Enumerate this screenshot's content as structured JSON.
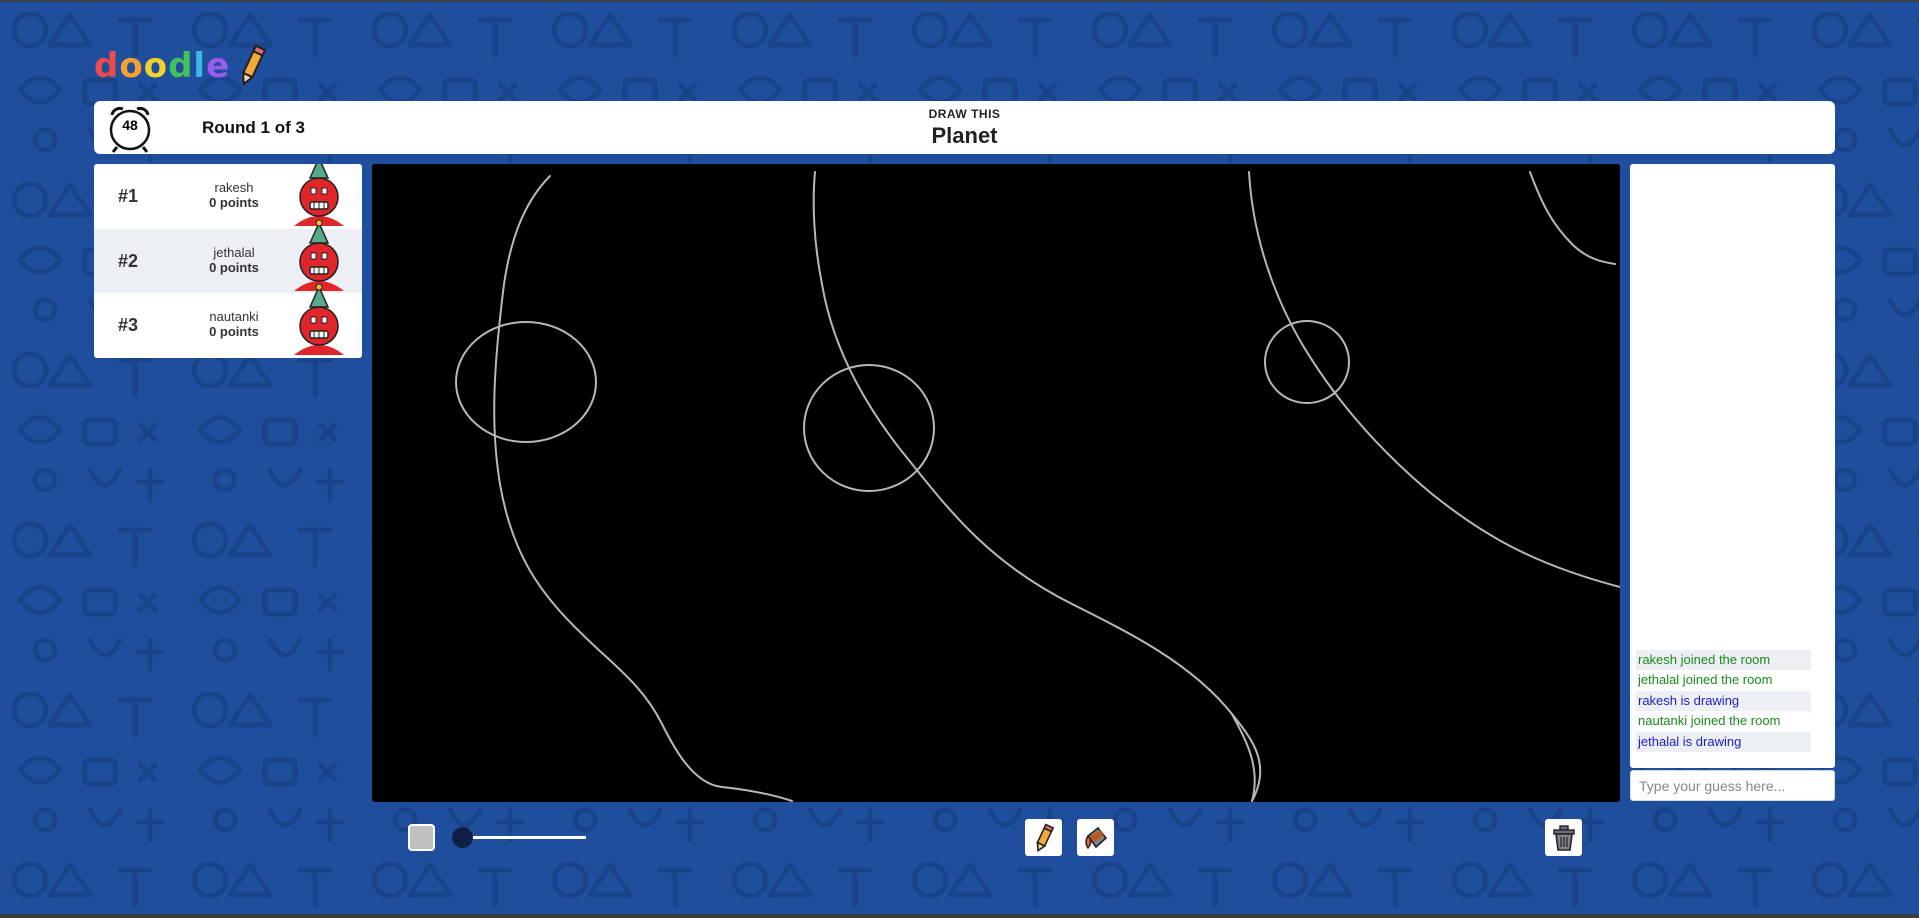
{
  "app": {
    "logo_letters": [
      "d",
      "o",
      "o",
      "d",
      "l",
      "e"
    ]
  },
  "game": {
    "timer": "48",
    "round": "Round 1 of 3",
    "prompt_label": "DRAW THIS",
    "word": "Planet"
  },
  "players": [
    {
      "rank": "#1",
      "name": "rakesh",
      "points": "0 points"
    },
    {
      "rank": "#2",
      "name": "jethalal",
      "points": "0 points"
    },
    {
      "rank": "#3",
      "name": "nautanki",
      "points": "0 points"
    }
  ],
  "chat": {
    "messages": [
      {
        "text": "rakesh joined the room",
        "kind": "join"
      },
      {
        "text": "jethalal joined the room",
        "kind": "join"
      },
      {
        "text": "rakesh is drawing",
        "kind": "draw"
      },
      {
        "text": "nautanki joined the room",
        "kind": "join"
      },
      {
        "text": "jethalal is drawing",
        "kind": "draw"
      }
    ],
    "placeholder": "Type your guess here..."
  },
  "toolbar": {
    "brush_color": "#c0c0c0",
    "tools": [
      "pencil-icon",
      "fill-bucket-icon",
      "trash-icon"
    ]
  },
  "colors": {
    "background": "#1f4e9c",
    "join_message": "#1a8a1a",
    "draw_message": "#1d1dc8"
  }
}
